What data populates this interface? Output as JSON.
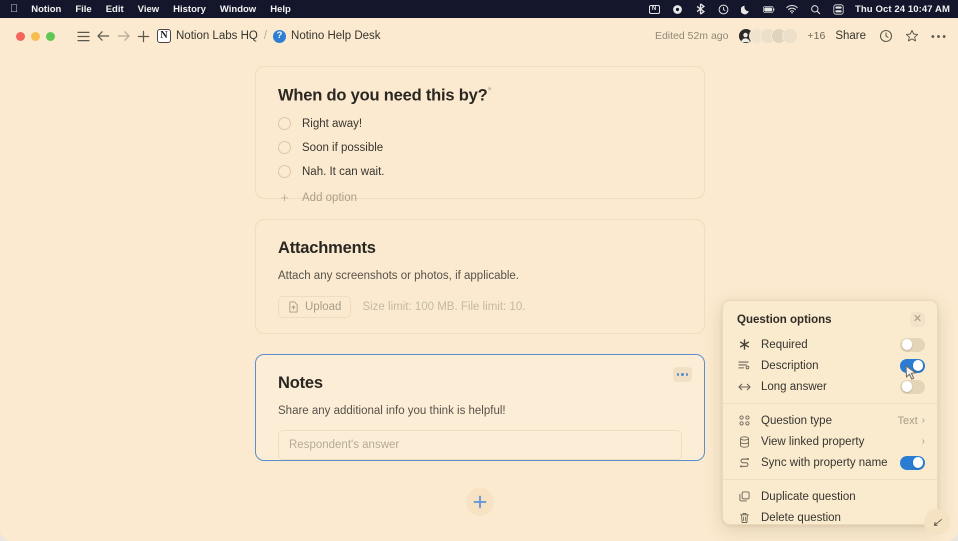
{
  "menubar": {
    "apple_icon": "apple-icon",
    "items": [
      "Notion",
      "File",
      "Edit",
      "View",
      "History",
      "Window",
      "Help"
    ],
    "status_icons": [
      "screen-mirroring-icon",
      "gear-icon",
      "bluetooth-icon",
      "clock-circle-icon",
      "moon-icon",
      "battery-icon",
      "wifi-icon",
      "search-icon",
      "control-center-icon"
    ],
    "clock": "Thu Oct 24  10:47 AM"
  },
  "toolbar": {
    "sidebar_icon": "hamburger-menu-icon",
    "back_icon": "arrow-left-icon",
    "forward_icon": "arrow-right-icon",
    "new_icon": "plus-icon",
    "workspace_badge": "N",
    "workspace": "Notion Labs HQ",
    "separator": "/",
    "page_badge": "?",
    "page_title": "Notino Help Desk",
    "edited": "Edited 52m ago",
    "collaborator_count": "+16",
    "share_label": "Share",
    "history_icon": "clock-icon",
    "favorite_icon": "star-icon",
    "more_icon": "ellipsis-icon"
  },
  "form": {
    "blocks": [
      {
        "name": "question-when-needed",
        "title": "When do you need this by?",
        "required_marker": "*",
        "options": [
          "Right away!",
          "Soon if possible",
          "Nah. It can wait."
        ],
        "add_option_label": "Add option"
      },
      {
        "name": "question-attachments",
        "title": "Attachments",
        "description": "Attach any screenshots or photos, if applicable.",
        "upload_label": "Upload",
        "limit_text": "Size limit: 100 MB. File limit: 10."
      },
      {
        "name": "question-notes",
        "title": "Notes",
        "description": "Share any additional info you think is helpful!",
        "answer_placeholder": "Respondent's answer"
      }
    ],
    "add_block_icon": "plus-icon"
  },
  "popup": {
    "title": "Question options",
    "close_icon": "close-icon",
    "toggles": [
      {
        "icon": "asterisk-icon",
        "label": "Required",
        "state": "off"
      },
      {
        "icon": "description-lines-icon",
        "label": "Description",
        "state": "on"
      },
      {
        "icon": "left-right-arrow-icon",
        "label": "Long answer",
        "state": "off"
      }
    ],
    "menu": [
      {
        "icon": "grid-dots-icon",
        "label": "Question type",
        "value": "Text",
        "chevron": "›"
      },
      {
        "icon": "database-icon",
        "label": "View linked property",
        "value": "",
        "chevron": "›"
      }
    ],
    "sync": {
      "icon": "sync-icon",
      "label": "Sync with property name",
      "state": "on"
    },
    "actions": [
      {
        "icon": "duplicate-icon",
        "label": "Duplicate question"
      },
      {
        "icon": "trash-icon",
        "label": "Delete question"
      }
    ]
  },
  "resize_handle": {
    "icon": "resize-cursor-icon",
    "glyph": "↙"
  },
  "colors": {
    "page_background": "#fbeacf",
    "accent_blue": "#2a7dd2",
    "selected_border": "#5b8fcb",
    "menubar": "#14162b"
  }
}
